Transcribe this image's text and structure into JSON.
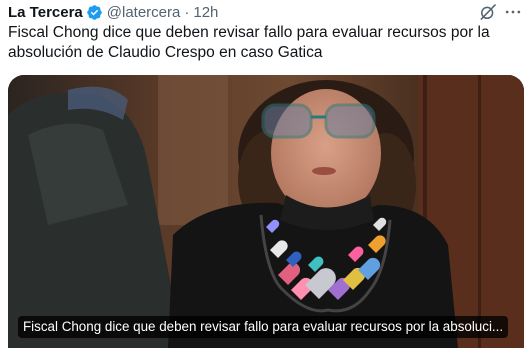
{
  "tweet": {
    "author_name": "La Tercera",
    "handle": "@latercera",
    "separator": "·",
    "time": "12h",
    "text": "Fiscal Chong dice que deben revisar fallo para evaluar recursos por la absolución de Claudio Crespo en caso Gatica"
  },
  "card": {
    "title": "Fiscal Chong dice que deben revisar fallo para evaluar recursos por la absoluci..."
  },
  "icons": {
    "verified": "verified-badge-icon",
    "grok": "grok-icon",
    "more": "more-options-icon"
  },
  "colors": {
    "verified_badge": "#1d9bf0",
    "text_primary": "#0f1419",
    "text_secondary": "#536471"
  }
}
